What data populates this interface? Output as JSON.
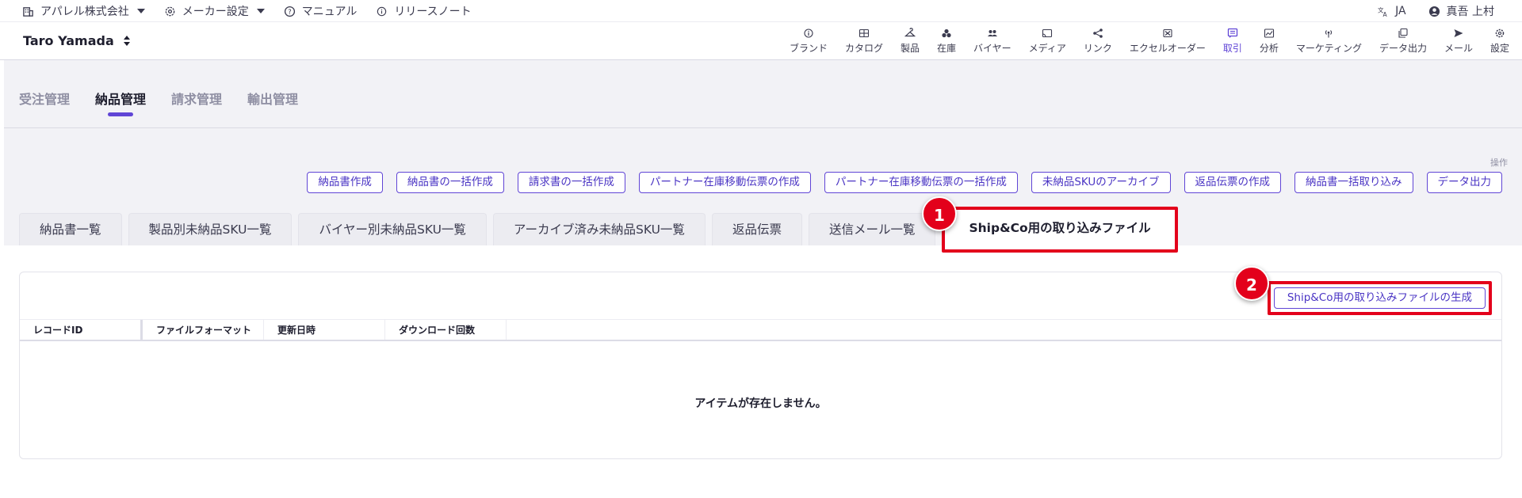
{
  "util": {
    "company": "アパレル株式会社",
    "maker_settings": "メーカー設定",
    "manual": "マニュアル",
    "release_notes": "リリースノート",
    "language": "JA",
    "user": "真吾 上村"
  },
  "header": {
    "store_name": "Taro Yamada",
    "nav": [
      {
        "label": "ブランド",
        "icon": "info-icon"
      },
      {
        "label": "カタログ",
        "icon": "catalog-icon"
      },
      {
        "label": "製品",
        "icon": "hanger-icon"
      },
      {
        "label": "在庫",
        "icon": "boxes-icon"
      },
      {
        "label": "バイヤー",
        "icon": "people-icon"
      },
      {
        "label": "メディア",
        "icon": "cast-icon"
      },
      {
        "label": "リンク",
        "icon": "share-icon"
      },
      {
        "label": "エクセルオーダー",
        "icon": "excel-icon"
      },
      {
        "label": "取引",
        "icon": "message-icon",
        "active": true
      },
      {
        "label": "分析",
        "icon": "chart-icon"
      },
      {
        "label": "マーケティング",
        "icon": "broadcast-icon"
      },
      {
        "label": "データ出力",
        "icon": "copy-icon"
      },
      {
        "label": "メール",
        "icon": "send-icon"
      },
      {
        "label": "設定",
        "icon": "gear-icon"
      }
    ]
  },
  "subtabs": [
    "受注管理",
    "納品管理",
    "請求管理",
    "輸出管理"
  ],
  "active_subtab": "納品管理",
  "ops_label": "操作",
  "actions": [
    "納品書作成",
    "納品書の一括作成",
    "請求書の一括作成",
    "パートナー在庫移動伝票の作成",
    "パートナー在庫移動伝票の一括作成",
    "未納品SKUのアーカイブ",
    "返品伝票の作成",
    "納品書一括取り込み",
    "データ出力"
  ],
  "tabs": [
    "納品書一覧",
    "製品別未納品SKU一覧",
    "バイヤー別未納品SKU一覧",
    "アーカイブ済み未納品SKU一覧",
    "返品伝票",
    "送信メール一覧",
    "Ship&Co用の取り込みファイル"
  ],
  "active_tab": "Ship&Co用の取り込みファイル",
  "card": {
    "generate_button": "Ship&Co用の取り込みファイルの生成",
    "columns": [
      "レコードID",
      "ファイルフォーマット",
      "更新日時",
      "ダウンロード回数"
    ],
    "empty_message": "アイテムが存在しません。"
  },
  "badges": [
    "1",
    "2"
  ],
  "colors": {
    "accent": "#6045d6",
    "highlight": "#e3001b"
  }
}
